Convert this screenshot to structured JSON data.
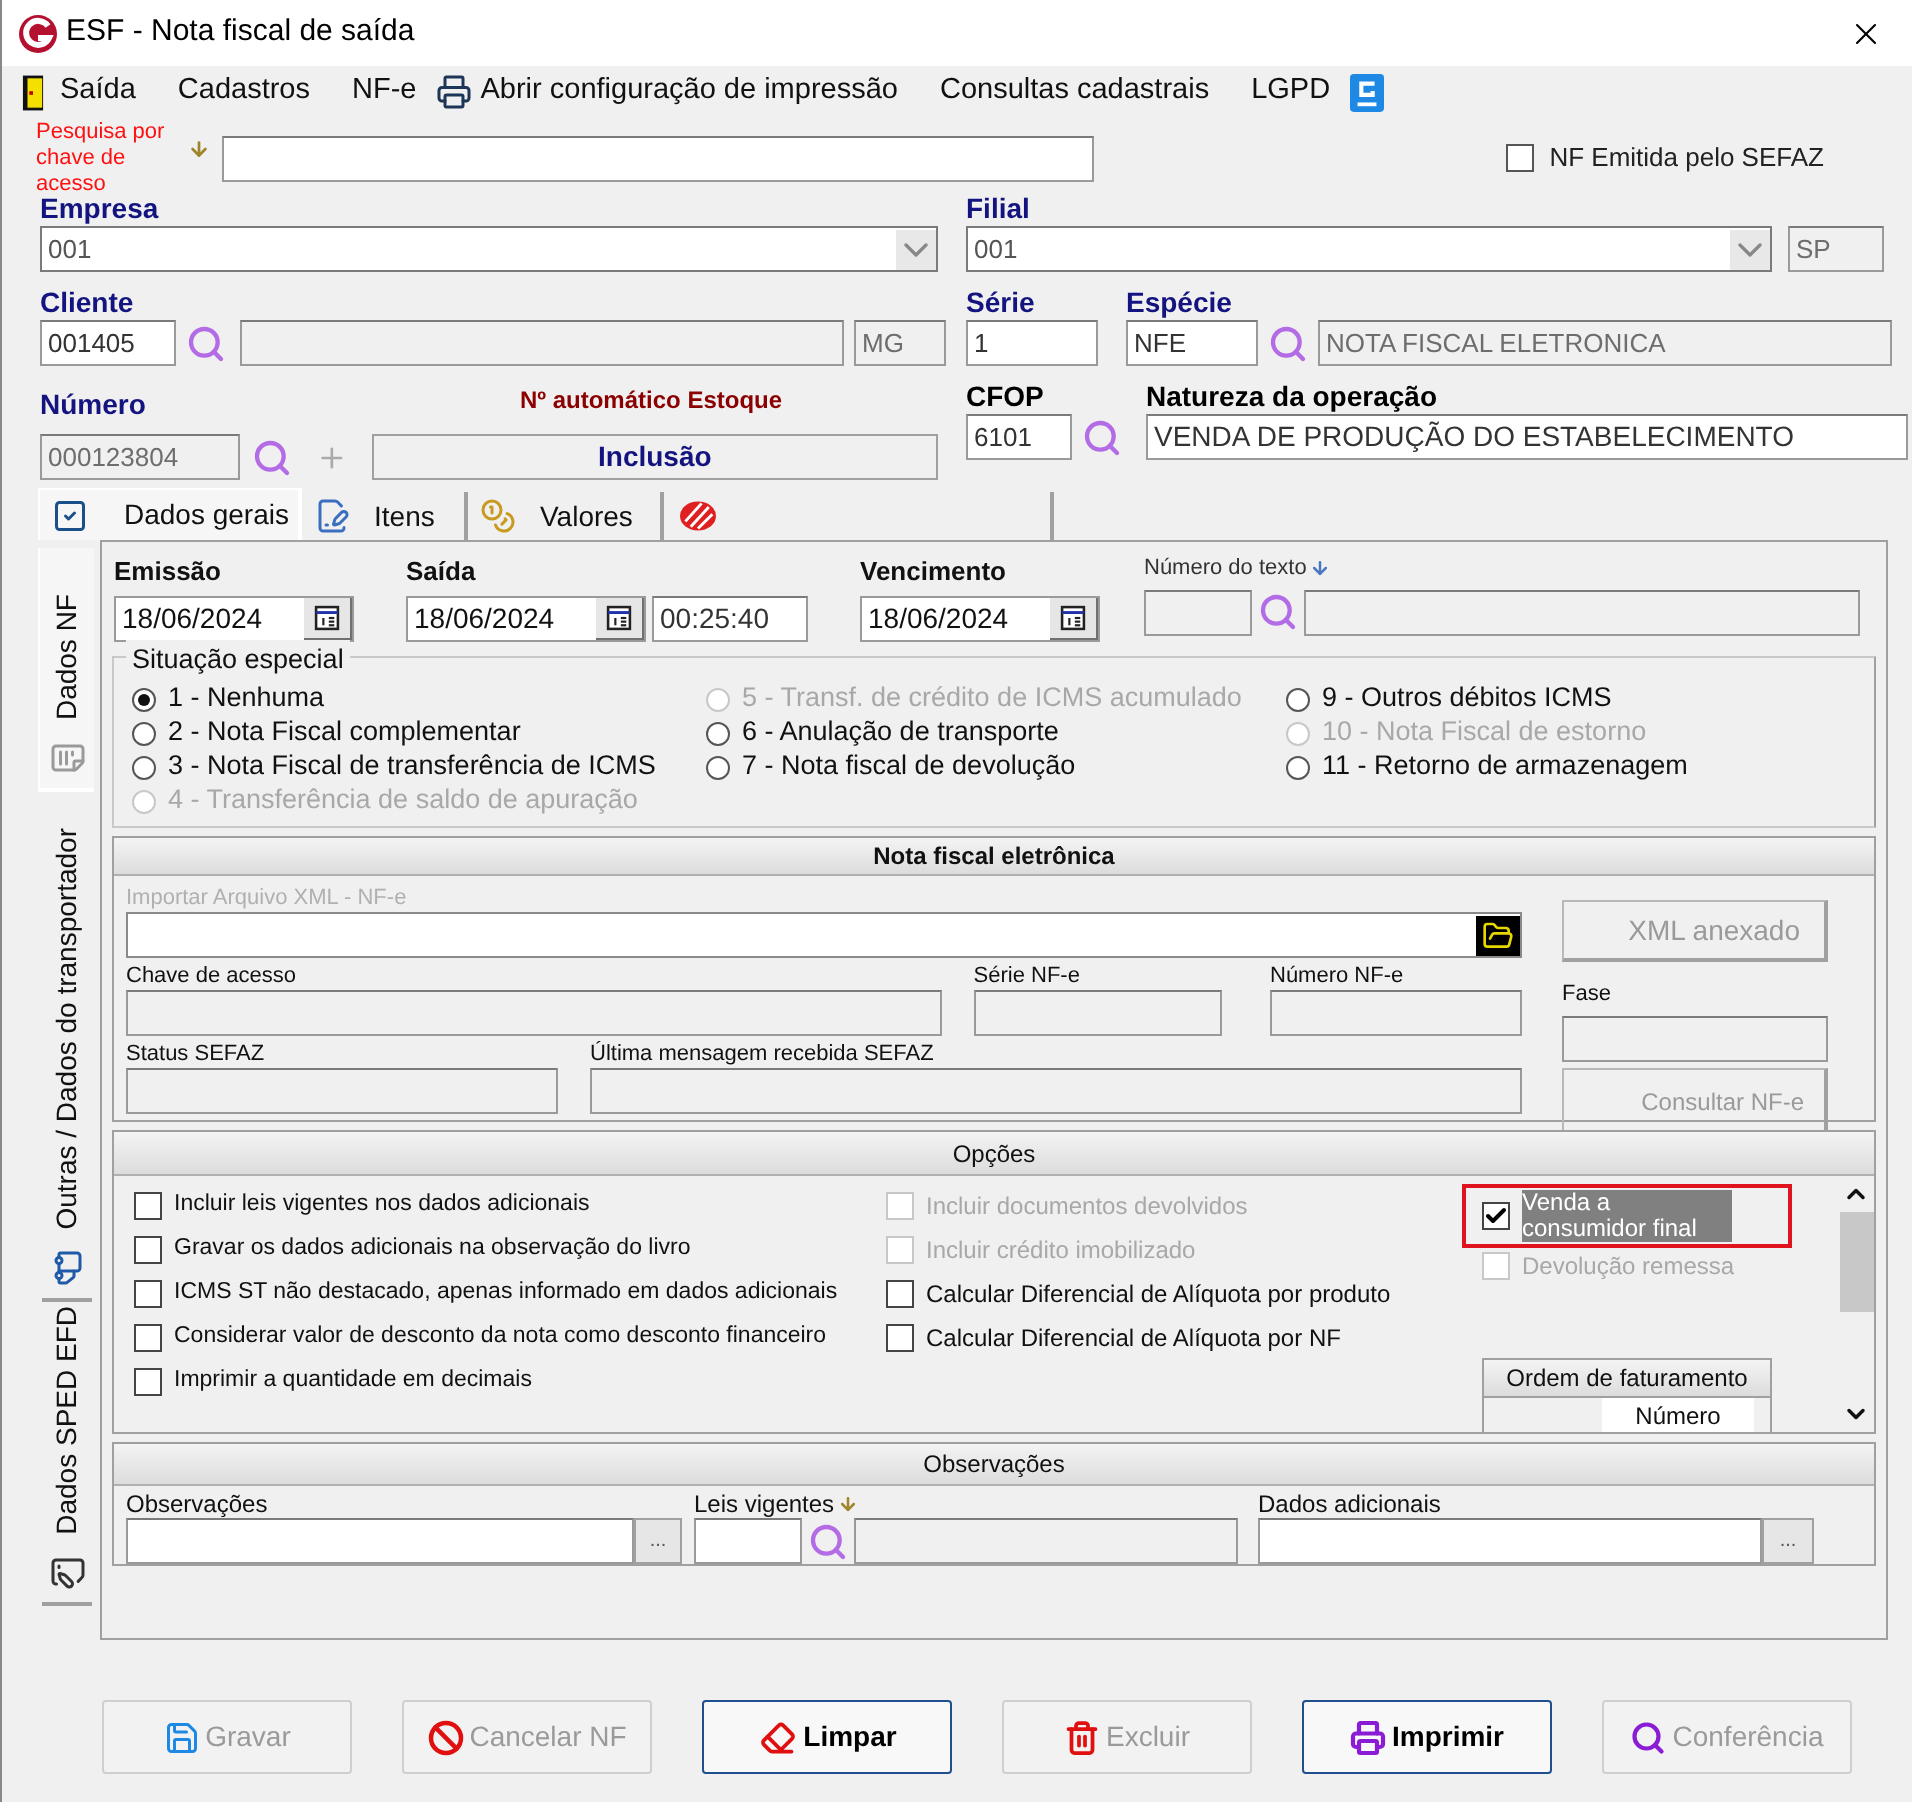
{
  "window": {
    "title": "ESF - Nota fiscal de saída"
  },
  "menu": [
    "Saída",
    "Cadastros",
    "NF-e",
    "Abrir configuração de impressão",
    "Consultas cadastrais",
    "LGPD"
  ],
  "search": {
    "label": "Pesquisa por chave de acesso"
  },
  "nf_sefaz": {
    "label": "NF Emitida pelo SEFAZ",
    "checked": false
  },
  "empresa": {
    "label": "Empresa",
    "value": "001"
  },
  "filial": {
    "label": "Filial",
    "value": "001",
    "uf": "SP"
  },
  "cliente": {
    "label": "Cliente",
    "code": "001405",
    "uf": "MG"
  },
  "serie": {
    "label": "Série",
    "value": "1"
  },
  "especie": {
    "label": "Espécie",
    "code": "NFE",
    "description": "NOTA FISCAL ELETRONICA"
  },
  "numero": {
    "label": "Número",
    "value": "000123804"
  },
  "auto_number": {
    "label": "Nº automático Estoque",
    "value": "Inclusão"
  },
  "cfop": {
    "label": "CFOP",
    "value": "6101"
  },
  "natureza": {
    "label": "Natureza da operação",
    "value": "VENDA DE PRODUÇÃO DO ESTABELECIMENTO"
  },
  "tabs": [
    {
      "label": "Dados gerais",
      "selected": true
    },
    {
      "label": "Itens",
      "selected": false
    },
    {
      "label": "Valores",
      "selected": false
    },
    {
      "selected": false
    }
  ],
  "side_tabs": [
    {
      "label": "Dados NF",
      "selected": true
    },
    {
      "label": "Outras / Dados do transportador",
      "selected": false
    },
    {
      "label": "Dados SPED EFD",
      "selected": false
    }
  ],
  "emissao": {
    "label": "Emissão",
    "value": "18/06/2024"
  },
  "saida": {
    "label": "Saída",
    "date": "18/06/2024",
    "time": "00:25:40"
  },
  "vencimento": {
    "label": "Vencimento",
    "value": "18/06/2024"
  },
  "numero_texto": {
    "label": "Número do texto"
  },
  "situacao": {
    "title": "Situação especial",
    "columns": [
      [
        {
          "label": "1 - Nenhuma",
          "selected": true,
          "disabled": false
        },
        {
          "label": "2 - Nota Fiscal complementar",
          "selected": false,
          "disabled": false
        },
        {
          "label": "3 - Nota Fiscal de transferência de ICMS",
          "selected": false,
          "disabled": false
        },
        {
          "label": "4 - Transferência de saldo de apuração",
          "selected": false,
          "disabled": true
        }
      ],
      [
        {
          "label": "5 - Transf. de crédito de ICMS acumulado",
          "selected": false,
          "disabled": true
        },
        {
          "label": "6 - Anulação de transporte",
          "selected": false,
          "disabled": false
        },
        {
          "label": "7 - Nota fiscal de devolução",
          "selected": false,
          "disabled": false
        }
      ],
      [
        {
          "label": "9 - Outros débitos ICMS",
          "selected": false,
          "disabled": false
        },
        {
          "label": "10 - Nota Fiscal de estorno",
          "selected": false,
          "disabled": true
        },
        {
          "label": "11 - Retorno de armazenagem",
          "selected": false,
          "disabled": false
        }
      ]
    ]
  },
  "nfe": {
    "title": "Nota fiscal eletrônica",
    "import_label": "Importar Arquivo XML - NF-e",
    "xml_button": "XML anexado",
    "chave": "Chave de acesso",
    "serie": "Série NF-e",
    "numero": "Número NF-e",
    "fase": "Fase",
    "status": "Status SEFAZ",
    "mensagem": "Última mensagem recebida SEFAZ",
    "consult_button": "Consultar NF-e"
  },
  "opcoes": {
    "title": "Opções",
    "columns": [
      [
        {
          "label": "Incluir leis vigentes nos dados adicionais",
          "checked": false,
          "disabled": false
        },
        {
          "label": "Gravar os dados adicionais na observação do livro",
          "checked": false,
          "disabled": false
        },
        {
          "label": "ICMS ST  não destacado, apenas informado em dados adicionais",
          "checked": false,
          "disabled": false
        },
        {
          "label": "Considerar valor de desconto da nota como desconto financeiro",
          "checked": false,
          "disabled": false
        },
        {
          "label": "Imprimir a quantidade em decimais",
          "checked": false,
          "disabled": false
        }
      ],
      [
        {
          "label": "Incluir documentos devolvidos",
          "checked": false,
          "disabled": true
        },
        {
          "label": "Incluir crédito imobilizado",
          "checked": false,
          "disabled": true
        },
        {
          "label": "Calcular Diferencial de Alíquota por produto",
          "checked": false,
          "disabled": false
        },
        {
          "label": "Calcular Diferencial de Alíquota por NF",
          "checked": false,
          "disabled": false
        }
      ],
      [
        {
          "label": "Venda a consumidor final",
          "checked": true,
          "disabled": false,
          "highlighted": true
        },
        {
          "label": "Devolução remessa",
          "checked": false,
          "disabled": true,
          "highlighted": false
        }
      ]
    ],
    "ordem": {
      "title": "Ordem de faturamento",
      "column": "Número"
    }
  },
  "observacoes": {
    "title": "Observações",
    "observacoes": "Observações",
    "leis": "Leis vigentes",
    "dados": "Dados adicionais",
    "more_button": "..."
  },
  "buttons": [
    {
      "label": "Gravar",
      "disabled": true
    },
    {
      "label": "Cancelar NF",
      "disabled": true
    },
    {
      "label": "Limpar",
      "disabled": false
    },
    {
      "label": "Excluir",
      "disabled": true
    },
    {
      "label": "Imprimir",
      "disabled": false
    },
    {
      "label": "Conferência",
      "disabled": true
    }
  ]
}
